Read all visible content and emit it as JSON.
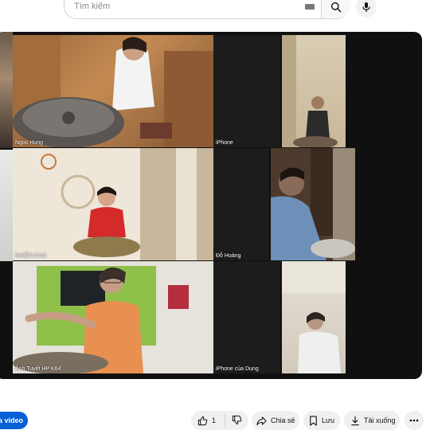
{
  "search": {
    "placeholder": "Tìm kiếm"
  },
  "video": {
    "tiles": [
      {
        "name": "Ngoc Hung"
      },
      {
        "name": "iPhone"
      },
      {
        "name": "NHIÊN CAO"
      },
      {
        "name": "Đỗ Hoàng"
      },
      {
        "name": "Ánh Tuyết HP K64"
      },
      {
        "name": "iPhone của Dung"
      }
    ]
  },
  "actions": {
    "left_button": "a video",
    "like_count": "1",
    "share": "Chia sẻ",
    "save": "Lưu",
    "download": "Tải xuống"
  }
}
